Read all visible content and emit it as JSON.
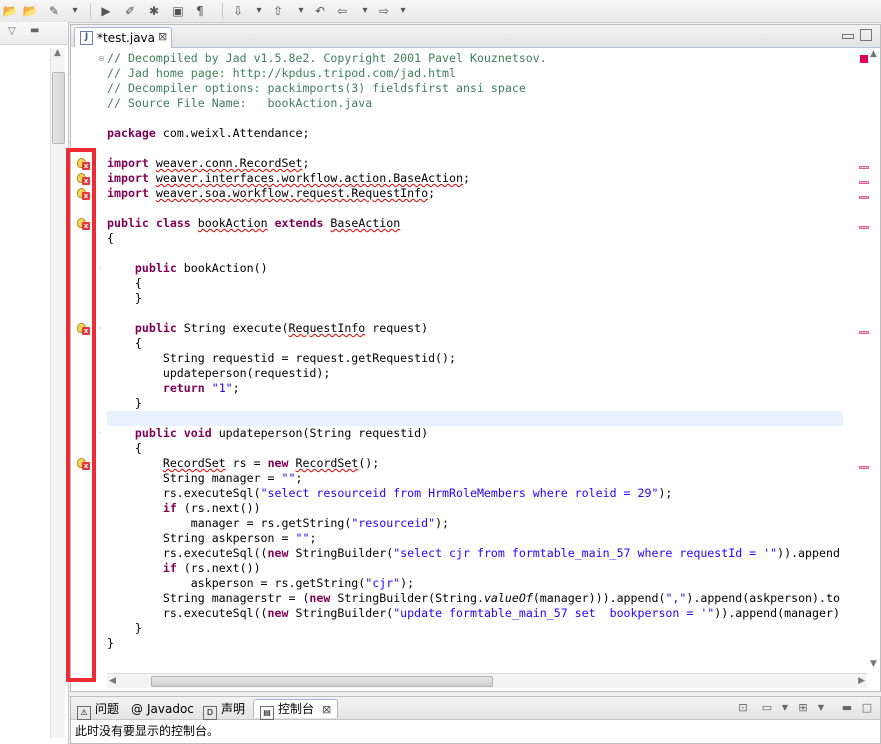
{
  "colors": {
    "comment": "#3f7f5f",
    "keyword": "#7f0055",
    "string": "#2a00ff",
    "error": "#e00000",
    "highlight_box": "#ee2a32",
    "overview_mark": "#e55b9c"
  },
  "toolbar": {
    "icons": [
      "open-folder-icon",
      "open-folder-icon",
      "pin-icon",
      "dropdown-icon",
      "run-icon",
      "highlight-icon",
      "debug-icon",
      "save-icon",
      "paragraph-icon",
      "next-annotation-icon",
      "dropdown-icon",
      "prev-annotation-icon",
      "dropdown-icon",
      "last-edit-icon",
      "back-icon",
      "dropdown-icon",
      "forward-icon",
      "dropdown-icon"
    ]
  },
  "editor": {
    "tab_label": "*test.java",
    "lines": [
      [
        {
          "t": "// Decompiled by Jad v1.5.8e2. Copyright 2001 Pavel Kouznetsov.",
          "c": "cm"
        }
      ],
      [
        {
          "t": "// Jad home page: http://kpdus.tripod.com/jad.html",
          "c": "cm"
        }
      ],
      [
        {
          "t": "// Decompiler options: packimports(3) fieldsfirst ansi space",
          "c": "cm"
        }
      ],
      [
        {
          "t": "// Source File Name:   bookAction.java",
          "c": "cm"
        }
      ],
      [],
      [
        {
          "t": "package",
          "c": "kw"
        },
        {
          "t": " com.weixl.Attendance;"
        }
      ],
      [],
      [
        {
          "t": "import",
          "c": "kw"
        },
        {
          "t": " "
        },
        {
          "t": "weaver.conn.RecordSet",
          "c": "err"
        },
        {
          "t": ";"
        }
      ],
      [
        {
          "t": "import",
          "c": "kw"
        },
        {
          "t": " "
        },
        {
          "t": "weaver.interfaces.workflow.action.BaseAction",
          "c": "err"
        },
        {
          "t": ";"
        }
      ],
      [
        {
          "t": "import",
          "c": "kw"
        },
        {
          "t": " "
        },
        {
          "t": "weaver.soa.workflow.request.RequestInfo",
          "c": "err"
        },
        {
          "t": ";"
        }
      ],
      [],
      [
        {
          "t": "public",
          "c": "kw"
        },
        {
          "t": " "
        },
        {
          "t": "class",
          "c": "kw"
        },
        {
          "t": " "
        },
        {
          "t": "bookAction",
          "c": "err"
        },
        {
          "t": " "
        },
        {
          "t": "extends",
          "c": "kw"
        },
        {
          "t": " "
        },
        {
          "t": "BaseAction",
          "c": "err"
        }
      ],
      [
        {
          "t": "{"
        }
      ],
      [],
      [
        {
          "t": "    "
        },
        {
          "t": "public",
          "c": "kw"
        },
        {
          "t": " bookAction()"
        }
      ],
      [
        {
          "t": "    {"
        }
      ],
      [
        {
          "t": "    }"
        }
      ],
      [],
      [
        {
          "t": "    "
        },
        {
          "t": "public",
          "c": "kw"
        },
        {
          "t": " String execute("
        },
        {
          "t": "RequestInfo",
          "c": "err"
        },
        {
          "t": " request)"
        }
      ],
      [
        {
          "t": "    {"
        }
      ],
      [
        {
          "t": "        String requestid = request.getRequestid();"
        }
      ],
      [
        {
          "t": "        updateperson(requestid);"
        }
      ],
      [
        {
          "t": "        "
        },
        {
          "t": "return",
          "c": "kw"
        },
        {
          "t": " "
        },
        {
          "t": "\"1\"",
          "c": "st"
        },
        {
          "t": ";"
        }
      ],
      [
        {
          "t": "    }"
        }
      ],
      [],
      [
        {
          "t": "    "
        },
        {
          "t": "public",
          "c": "kw"
        },
        {
          "t": " "
        },
        {
          "t": "void",
          "c": "kw"
        },
        {
          "t": " updateperson(String requestid)"
        }
      ],
      [
        {
          "t": "    {"
        }
      ],
      [
        {
          "t": "        "
        },
        {
          "t": "RecordSet",
          "c": "err"
        },
        {
          "t": " rs = "
        },
        {
          "t": "new",
          "c": "kw"
        },
        {
          "t": " "
        },
        {
          "t": "RecordSet",
          "c": "err"
        },
        {
          "t": "();"
        }
      ],
      [
        {
          "t": "        String manager = "
        },
        {
          "t": "\"\"",
          "c": "st"
        },
        {
          "t": ";"
        }
      ],
      [
        {
          "t": "        rs.executeSql("
        },
        {
          "t": "\"select resourceid from HrmRoleMembers where roleid = 29\"",
          "c": "st"
        },
        {
          "t": ");"
        }
      ],
      [
        {
          "t": "        "
        },
        {
          "t": "if",
          "c": "kw"
        },
        {
          "t": " (rs.next())"
        }
      ],
      [
        {
          "t": "            manager = rs.getString("
        },
        {
          "t": "\"resourceid\"",
          "c": "st"
        },
        {
          "t": ");"
        }
      ],
      [
        {
          "t": "        String askperson = "
        },
        {
          "t": "\"\"",
          "c": "st"
        },
        {
          "t": ";"
        }
      ],
      [
        {
          "t": "        rs.executeSql(("
        },
        {
          "t": "new",
          "c": "kw"
        },
        {
          "t": " StringBuilder("
        },
        {
          "t": "\"select cjr from formtable_main_57 where requestId = '\"",
          "c": "st"
        },
        {
          "t": ")).append"
        }
      ],
      [
        {
          "t": "        "
        },
        {
          "t": "if",
          "c": "kw"
        },
        {
          "t": " (rs.next())"
        }
      ],
      [
        {
          "t": "            askperson = rs.getString("
        },
        {
          "t": "\"cjr\"",
          "c": "st"
        },
        {
          "t": ");"
        }
      ],
      [
        {
          "t": "        String managerstr = ("
        },
        {
          "t": "new",
          "c": "kw"
        },
        {
          "t": " StringBuilder(String."
        },
        {
          "t": "valueOf",
          "c": "it"
        },
        {
          "t": "(manager))).append("
        },
        {
          "t": "\",\"",
          "c": "st"
        },
        {
          "t": ").append(askperson).to"
        }
      ],
      [
        {
          "t": "        rs.executeSql(("
        },
        {
          "t": "new",
          "c": "kw"
        },
        {
          "t": " StringBuilder("
        },
        {
          "t": "\"update formtable_main_57 set  bookperson = '\"",
          "c": "st"
        },
        {
          "t": ")).append(manager)"
        }
      ],
      [
        {
          "t": "    }"
        }
      ],
      [
        {
          "t": "}"
        }
      ]
    ],
    "error_lines": [
      7,
      8,
      9,
      11,
      18,
      27
    ],
    "fold_lines": [
      0,
      14,
      18,
      25
    ],
    "current_line": 24
  },
  "bottom_panel": {
    "tabs": [
      {
        "label": "问题",
        "icon": "problems-icon"
      },
      {
        "label": "Javadoc",
        "icon": "javadoc-icon"
      },
      {
        "label": "声明",
        "icon": "declaration-icon"
      },
      {
        "label": "控制台",
        "icon": "console-icon",
        "active": true
      }
    ],
    "console_message": "此时没有要显示的控制台。"
  }
}
